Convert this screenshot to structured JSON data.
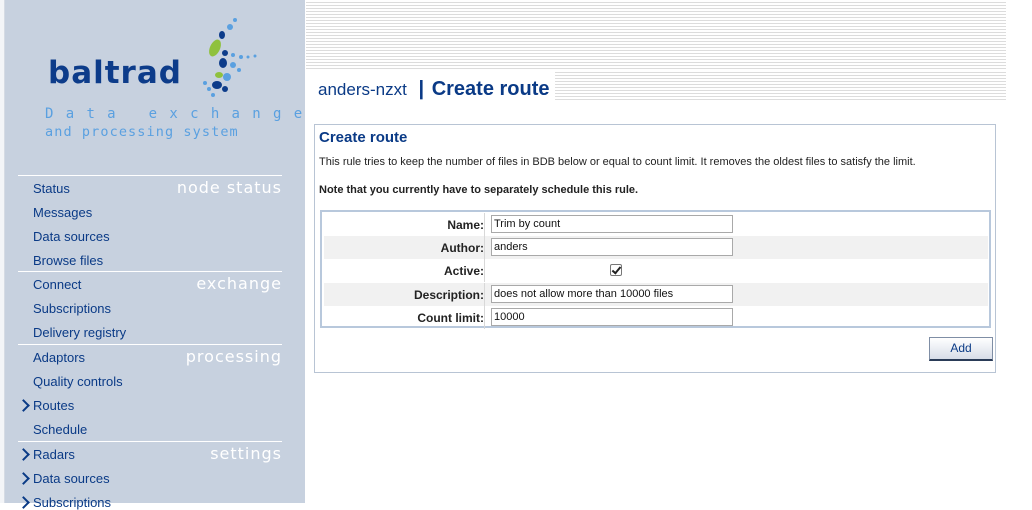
{
  "logo": {
    "wordmark": "baltrad",
    "tagline_line1": "Data exchange",
    "tagline_line2": "and processing system"
  },
  "sidebar": {
    "sections": [
      {
        "heading": "node status",
        "items": [
          {
            "label": "Status"
          },
          {
            "label": "Messages"
          },
          {
            "label": "Data sources"
          },
          {
            "label": "Browse files"
          }
        ]
      },
      {
        "heading": "exchange",
        "items": [
          {
            "label": "Connect"
          },
          {
            "label": "Subscriptions"
          },
          {
            "label": "Delivery registry"
          }
        ]
      },
      {
        "heading": "processing",
        "items": [
          {
            "label": "Adaptors"
          },
          {
            "label": "Quality controls"
          },
          {
            "label": "Routes",
            "expandable": true
          },
          {
            "label": "Schedule"
          }
        ]
      },
      {
        "heading": "settings",
        "items": [
          {
            "label": "Radars",
            "expandable": true
          },
          {
            "label": "Data sources",
            "expandable": true
          },
          {
            "label": "Subscriptions",
            "expandable": true
          }
        ]
      }
    ]
  },
  "header": {
    "node_name": "anders-nzxt",
    "separator": "|",
    "page_title": "Create route"
  },
  "panel": {
    "title": "Create route",
    "description": "This rule tries to keep the number of files in BDB below or equal to count limit. It removes the oldest files to satisfy the limit.",
    "note": "Note that you currently have to separately schedule this rule."
  },
  "form": {
    "name_label": "Name:",
    "name_value": "Trim by count",
    "author_label": "Author:",
    "author_value": "anders",
    "active_label": "Active:",
    "active_checked": true,
    "description_label": "Description:",
    "description_value": "does not allow more than 10000 files",
    "count_limit_label": "Count limit:",
    "count_limit_value": "10000",
    "add_label": "Add"
  },
  "colors": {
    "sidebar_bg": "#c7d1df",
    "link": "#0a3a86",
    "logo_dark": "#0d3c8a",
    "logo_light": "#5aa0e0",
    "logo_green": "#8fc13e"
  }
}
